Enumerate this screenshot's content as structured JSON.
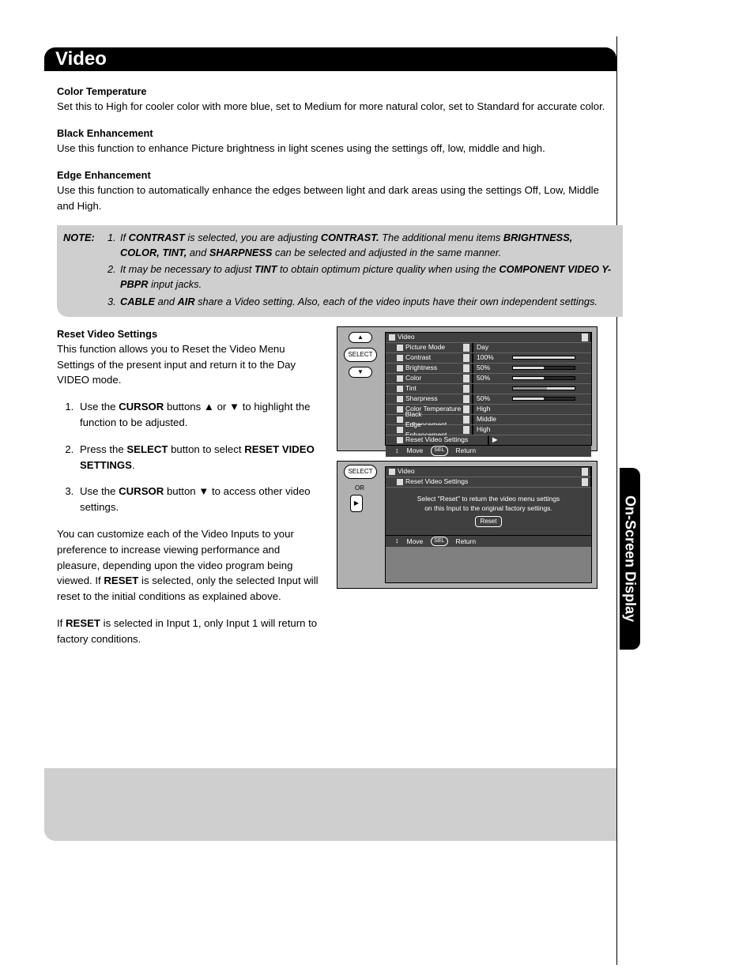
{
  "header": "Video",
  "side_tab": "On-Screen Display",
  "sections": {
    "color_temp": {
      "title": "Color Temperature",
      "body": "Set this to High for cooler color with more blue, set to Medium for more natural color, set to Standard for accurate color."
    },
    "black_enh": {
      "title": "Black Enhancement",
      "body": "Use this function to enhance Picture brightness in light scenes using the settings off, low, middle and high."
    },
    "edge_enh": {
      "title": "Edge Enhancement",
      "body": "Use this function to automatically enhance the edges between light and dark areas using the settings Off, Low, Middle and High."
    },
    "reset": {
      "title": "Reset Video Settings",
      "body": "This function allows you to Reset the Video Menu Settings of the present input and return it to the Day VIDEO mode.",
      "step1_a": "Use the ",
      "step1_b": "CURSOR",
      "step1_c": " buttons ▲ or ▼ to highlight the function to be adjusted.",
      "step2_a": "Press the ",
      "step2_b": "SELECT",
      "step2_c": " button to select ",
      "step2_d": "RESET VIDEO SETTINGS",
      "step2_e": ".",
      "step3_a": "Use the ",
      "step3_b": "CURSOR",
      "step3_c": " button ▼ to access other video settings.",
      "para2_a": "You can customize each of the Video Inputs to your preference to increase viewing performance and pleasure, depending upon the video program being viewed. If ",
      "para2_b": "RESET",
      "para2_c": " is selected, only the selected Input will reset to the initial conditions as explained above.",
      "para3_a": "If ",
      "para3_b": "RESET",
      "para3_c": " is selected in Input 1, only Input 1 will return to factory conditions."
    }
  },
  "note": {
    "label": "NOTE:",
    "n1_a": "If ",
    "n1_b": "CONTRAST",
    "n1_c": " is selected, you are adjusting ",
    "n1_d": "CONTRAST.",
    "n1_e": " The additional menu items ",
    "n1_f": "BRIGHTNESS, COLOR, TINT,",
    "n1_g": " and ",
    "n1_h": "SHARPNESS",
    "n1_i": " can be selected and adjusted in the same manner.",
    "n2_a": "It may be necessary to adjust ",
    "n2_b": "TINT",
    "n2_c": " to obtain optimum picture quality when using the ",
    "n2_d": "COMPONENT VIDEO Y-PBPR",
    "n2_e": " input jacks.",
    "n3_a": "CABLE",
    "n3_b": " and ",
    "n3_c": "AIR",
    "n3_d": " share a Video setting. Also, each of the video inputs have their own independent settings."
  },
  "osd1": {
    "title": "Video",
    "rows": [
      {
        "label": "Picture Mode",
        "val": "Day",
        "type": "text"
      },
      {
        "label": "Contrast",
        "val": "100%",
        "type": "bar",
        "pct": 100
      },
      {
        "label": "Brightness",
        "val": "50%",
        "type": "bar",
        "pct": 50
      },
      {
        "label": "Color",
        "val": "50%",
        "type": "bar",
        "pct": 50
      },
      {
        "label": "Tint",
        "val": "",
        "type": "tint"
      },
      {
        "label": "Sharpness",
        "val": "50%",
        "type": "bar",
        "pct": 50
      },
      {
        "label": "Color Temperature",
        "val": "High",
        "type": "text"
      },
      {
        "label": "Black Enhancement",
        "val": "Middle",
        "type": "text"
      },
      {
        "label": "Edge Enhancement",
        "val": "High",
        "type": "text"
      },
      {
        "label": "Reset Video Settings",
        "val": "",
        "type": "arrow"
      }
    ],
    "foot_move": "Move",
    "foot_return": "Return",
    "foot_sel": "SEL"
  },
  "osd2": {
    "or": "OR",
    "title": "Video",
    "sub": "Reset Video Settings",
    "msg1": "Select \"Reset\" to return the video menu settings",
    "msg2": "on this Input to the original factory settings.",
    "btn": "Reset",
    "foot_move": "Move",
    "foot_return": "Return",
    "foot_sel": "SEL"
  },
  "remote": {
    "select": "SELECT"
  }
}
